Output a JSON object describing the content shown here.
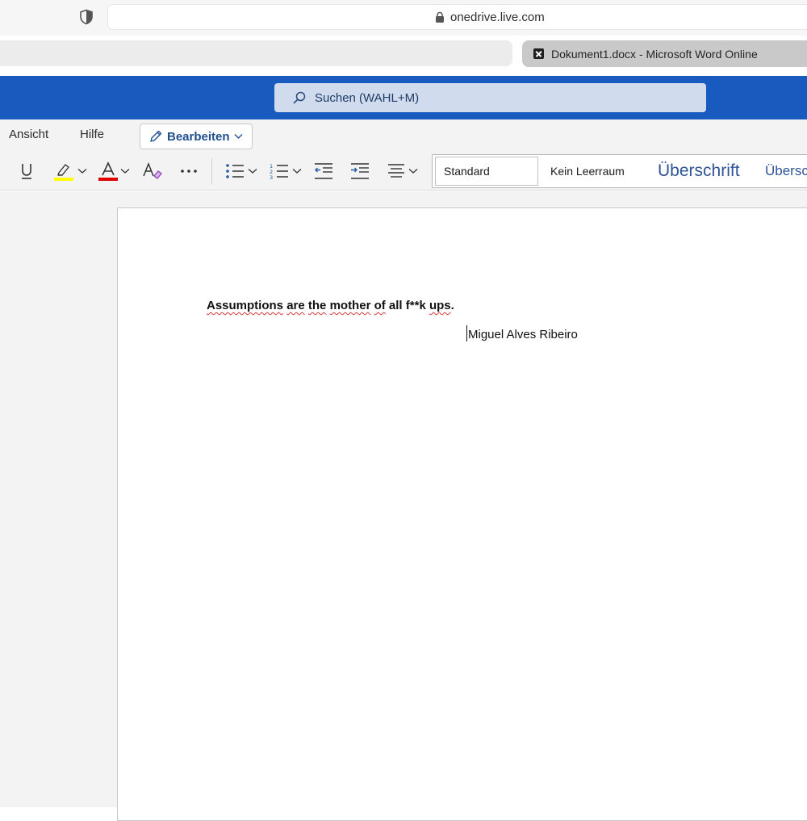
{
  "browser": {
    "url": "onedrive.live.com",
    "active_tab_title": "Dokument1.docx - Microsoft Word Online"
  },
  "header": {
    "search_placeholder": "Suchen (WAHL+M)"
  },
  "menu": {
    "items": [
      "Ansicht",
      "Hilfe"
    ],
    "edit_button": "Bearbeiten"
  },
  "styles": {
    "items": [
      "Standard",
      "Kein Leerraum",
      "Überschrift",
      "Übersc"
    ]
  },
  "document": {
    "quote_words": [
      "Assumptions",
      "are",
      "the",
      "mother",
      "of",
      "all",
      "f**k",
      "ups",
      "."
    ],
    "author": "Miguel Alves Ribeiro"
  },
  "colors": {
    "word_blue": "#185abd",
    "highlight_yellow": "#ffff00",
    "font_red": "#e00000"
  }
}
